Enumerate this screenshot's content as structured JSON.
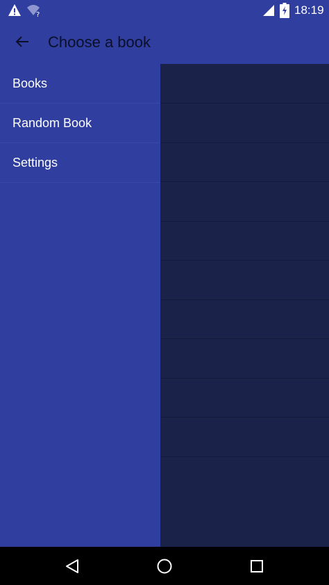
{
  "status_bar": {
    "time": "18:19",
    "icons": [
      "warning-icon",
      "wifi-question-icon",
      "signal-icon",
      "battery-charging-icon"
    ]
  },
  "toolbar": {
    "back_icon": "arrow-back-icon",
    "title": "Choose a book"
  },
  "drawer": {
    "items": [
      {
        "label": "Books"
      },
      {
        "label": "Random Book"
      },
      {
        "label": "Settings"
      }
    ]
  },
  "nav_bar": {
    "icons": [
      "back-triangle-icon",
      "home-circle-icon",
      "recents-square-icon"
    ]
  },
  "colors": {
    "primary": "#303f9f",
    "scrim": "#1b2249",
    "title_text": "#0b0f2a",
    "nav_bar": "#000000"
  }
}
